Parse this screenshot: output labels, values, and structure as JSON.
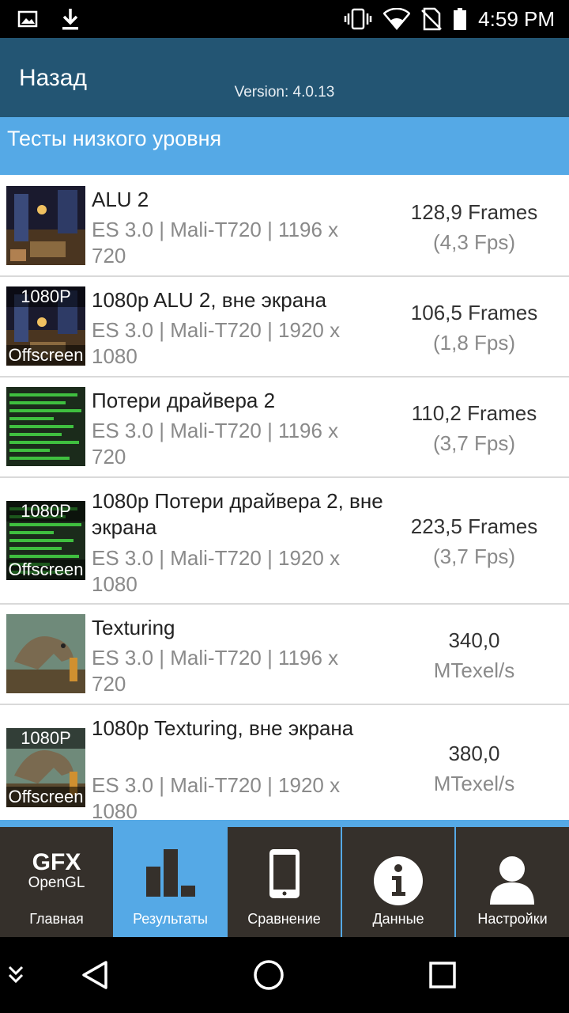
{
  "status_bar": {
    "time": "4:59 PM"
  },
  "app_bar": {
    "back_label": "Назад",
    "version": "Version: 4.0.13"
  },
  "section": {
    "title": "Тесты низкого уровня"
  },
  "results": [
    {
      "thumb": "alu-scene",
      "badge_top": "",
      "badge_bottom": "",
      "title": "ALU 2",
      "subtitle": "ES 3.0 | Mali-T720 | 1196 x 720",
      "value": "128,9 Frames",
      "secondary": "(4,3 Fps)"
    },
    {
      "thumb": "alu-scene",
      "badge_top": "1080P",
      "badge_bottom": "Offscreen",
      "title": "1080p ALU 2, вне экрана",
      "subtitle": "ES 3.0 | Mali-T720 | 1920 x 1080",
      "value": "106,5 Frames",
      "secondary": "(1,8 Fps)"
    },
    {
      "thumb": "driver-graph",
      "badge_top": "",
      "badge_bottom": "",
      "title": "Потери драйвера 2",
      "subtitle": "ES 3.0 | Mali-T720 | 1196 x 720",
      "value": "110,2 Frames",
      "secondary": "(3,7 Fps)"
    },
    {
      "thumb": "driver-graph",
      "badge_top": "1080P",
      "badge_bottom": "Offscreen",
      "title": "1080p Потери драйвера 2, вне экрана",
      "subtitle": "ES 3.0 | Mali-T720 | 1920 x 1080",
      "value": "223,5 Frames",
      "secondary": "(3,7 Fps)"
    },
    {
      "thumb": "dinosaur-scene",
      "badge_top": "",
      "badge_bottom": "",
      "title": "Texturing",
      "subtitle": "ES 3.0 | Mali-T720 | 1196 x 720",
      "value": "340,0",
      "secondary": "MTexel/s"
    },
    {
      "thumb": "dinosaur-scene",
      "badge_top": "1080P",
      "badge_bottom": "Offscreen",
      "title": "1080p Texturing, вне экрана",
      "subtitle": "ES 3.0 | Mali-T720 | 1920 x 1080",
      "value": "380,0",
      "secondary": "MTexel/s"
    }
  ],
  "tabs": [
    {
      "label": "Главная",
      "icon": "gfx-opengl-logo",
      "logo_main": "GFX",
      "logo_sub": "OpenGL",
      "active": false
    },
    {
      "label": "Результаты",
      "icon": "bar-chart-icon",
      "active": true
    },
    {
      "label": "Сравнение",
      "icon": "phone-icon",
      "active": false
    },
    {
      "label": "Данные",
      "icon": "info-icon",
      "active": false
    },
    {
      "label": "Настройки",
      "icon": "person-icon",
      "active": false
    }
  ],
  "colors": {
    "app_bar": "#235573",
    "accent": "#55a9e6",
    "tab_bg": "#35302b"
  }
}
